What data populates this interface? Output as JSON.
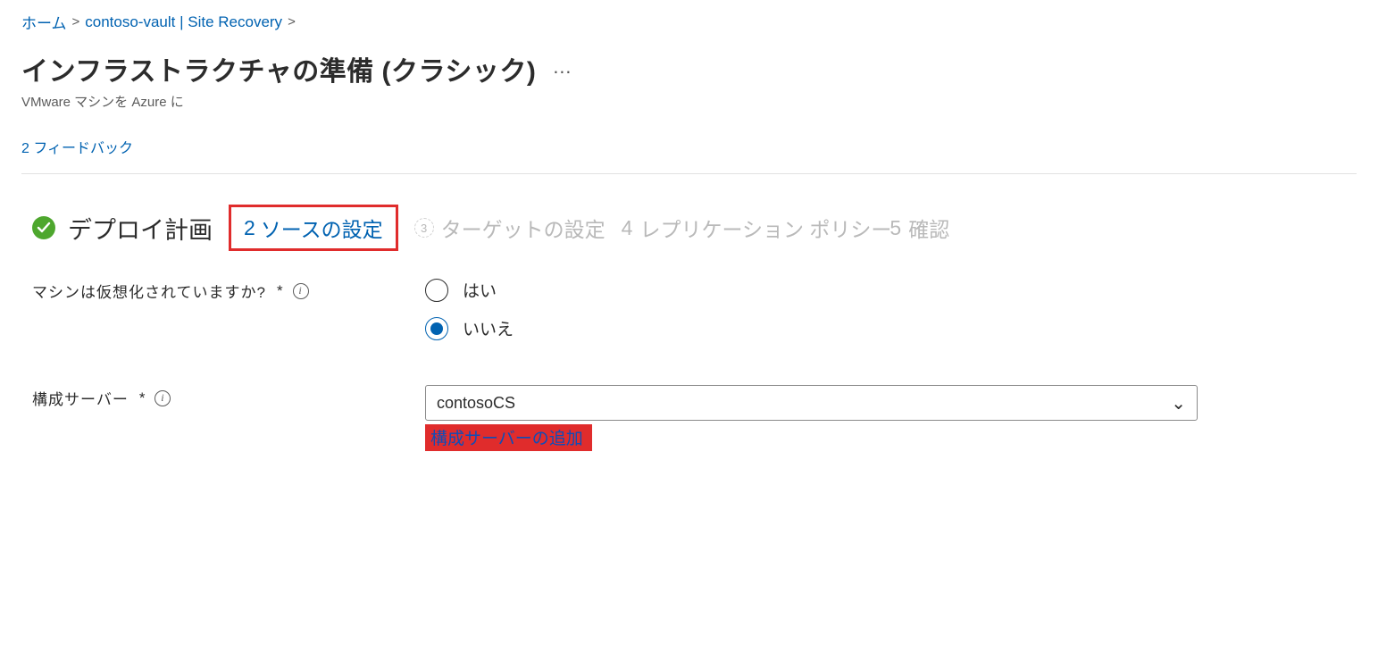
{
  "breadcrumb": {
    "home": "ホーム",
    "vault": "contoso-vault | Site Recovery"
  },
  "header": {
    "title": "インフラストラクチャの準備 (クラシック)",
    "subtitle": "VMware マシンを Azure に",
    "more": "…"
  },
  "toolbar": {
    "feedback": "フィードバック",
    "feedback_num": "2"
  },
  "steps": {
    "s1_label": "デプロイ計画",
    "s2_num": "2",
    "s2_label": "ソースの設定",
    "s3_num": "3",
    "s3_label": "ターゲットの設定",
    "s4_num": "4",
    "s4_label": "レプリケーション ポリシー",
    "s5_num": "5",
    "s5_label": "確認"
  },
  "form": {
    "virtualized_label": "マシンは仮想化されていますか?",
    "required_marker": "*",
    "info_glyph": "i",
    "radio_yes": "はい",
    "radio_no": "いいえ",
    "config_server_label": "構成サーバー",
    "config_server_value": "contosoCS",
    "add_config_server": "構成サーバーの追加"
  }
}
